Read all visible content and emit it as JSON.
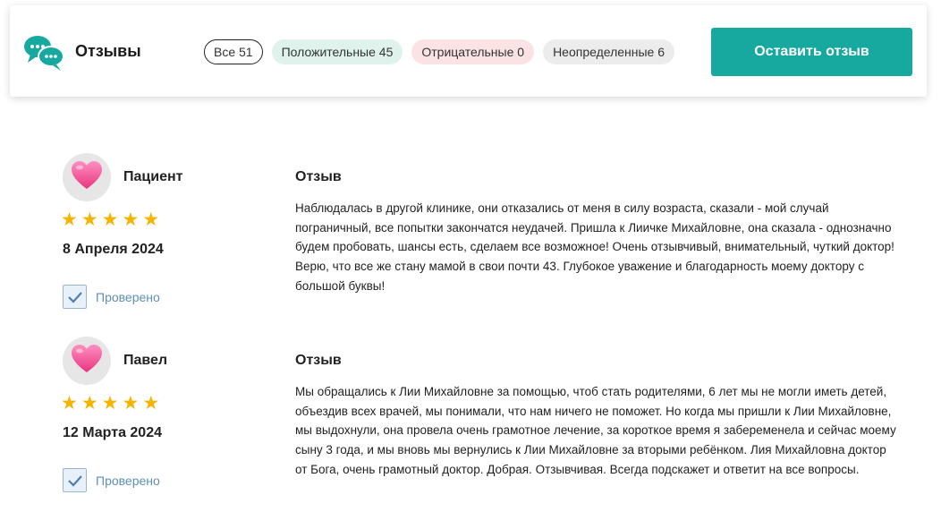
{
  "header": {
    "title": "Отзывы",
    "logo_icon": "chat-bubbles-icon",
    "filters": [
      {
        "label": "Все 51"
      },
      {
        "label": "Положительные 45"
      },
      {
        "label": "Отрицательные 0"
      },
      {
        "label": "Неопределенные 6"
      }
    ],
    "cta_label": "Оставить отзыв"
  },
  "colors": {
    "accent": "#17a9a0",
    "star": "#f4b400",
    "verified": "#5f8fb7",
    "positive_chip": "#dff3ec",
    "negative_chip": "#fbe3e4",
    "neutral_chip": "#ececec"
  },
  "reviews": [
    {
      "author": "Пациент",
      "avatar_icon": "heart-icon",
      "rating": 5,
      "stars": "★★★★★",
      "date": "8 Апреля 2024",
      "verified_label": "Проверено",
      "heading": "Отзыв",
      "text": "Наблюдалась в другой клинике, они отказались от меня в силу возраста, сказали - мой случай пограничный, все попытки закончатся неудачей. Пришла к Лиичке Михайловне, она сказала - однозначно будем пробовать, шансы есть, сделаем все возможное! Очень отзывчивый, внимательный, чуткий доктор! Верю, что все же стану мамой в свои почти 43. Глубокое уважение и благодарность моему доктору с большой буквы!"
    },
    {
      "author": "Павел",
      "avatar_icon": "heart-icon",
      "rating": 5,
      "stars": "★★★★★",
      "date": "12 Марта 2024",
      "verified_label": "Проверено",
      "heading": "Отзыв",
      "text": "Мы обращались к Лии Михайловне за помощью, чтоб стать родителями, 6 лет мы не могли иметь детей, объездив всех врачей, мы понимали, что нам ничего не поможет. Но когда мы пришли к Лии Михайловне, мы выдохнули, она провела очень грамотное лечение, за короткое время я забеременела и сейчас моему сыну 3 года, и мы вновь мы вернулись к Лии Михайловне за вторыми ребёнком. Лия Михайловна доктор от Бога, очень грамотный доктор. Добрая. Отзывчивая. Всегда подскажет и ответит на все вопросы."
    }
  ]
}
